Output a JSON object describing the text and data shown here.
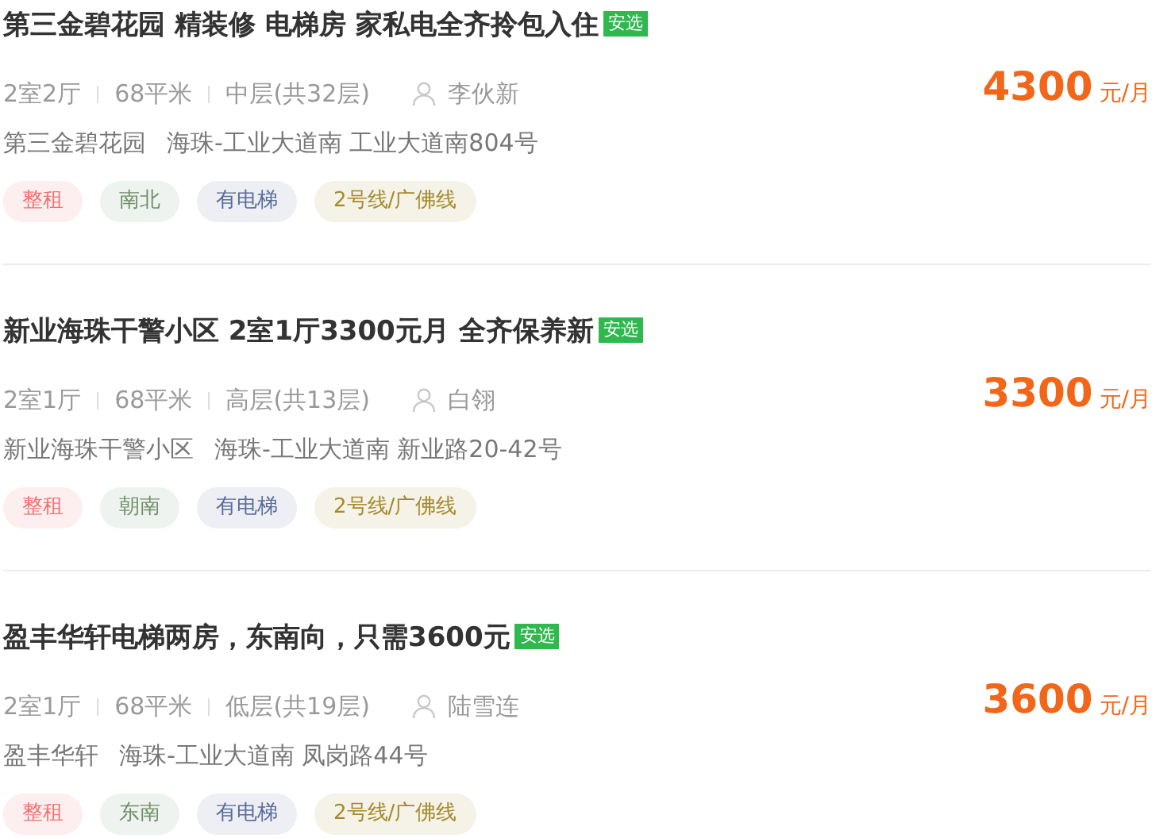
{
  "listings": [
    {
      "title": "第三金碧花园 精装修 电梯房 家私电全齐拎包入住",
      "badge": "安选",
      "layout": "2室2厅",
      "area": "68平米",
      "floor": "中层(共32层)",
      "agent": "李伙新",
      "community": "第三金碧花园",
      "address": "海珠-工业大道南 工业大道南804号",
      "price": "4300",
      "unit": "元/月",
      "tags": [
        {
          "label": "整租",
          "color": "#f07272"
        },
        {
          "label": "南北",
          "color": "#6f8f6a"
        },
        {
          "label": "有电梯",
          "color": "#5a6c9a"
        },
        {
          "label": "2号线/广佛线",
          "color": "#a48a2a"
        }
      ]
    },
    {
      "title": "新业海珠干警小区 2室1厅3300元月 全齐保养新",
      "badge": "安选",
      "layout": "2室1厅",
      "area": "68平米",
      "floor": "高层(共13层)",
      "agent": "白翎",
      "community": "新业海珠干警小区",
      "address": "海珠-工业大道南 新业路20-42号",
      "price": "3300",
      "unit": "元/月",
      "tags": [
        {
          "label": "整租",
          "color": "#f07272"
        },
        {
          "label": "朝南",
          "color": "#6f8f6a"
        },
        {
          "label": "有电梯",
          "color": "#5a6c9a"
        },
        {
          "label": "2号线/广佛线",
          "color": "#a48a2a"
        }
      ]
    },
    {
      "title": "盈丰华轩电梯两房，东南向，只需3600元",
      "badge": "安选",
      "layout": "2室1厅",
      "area": "68平米",
      "floor": "低层(共19层)",
      "agent": "陆雪连",
      "community": "盈丰华轩",
      "address": "海珠-工业大道南 凤岗路44号",
      "price": "3600",
      "unit": "元/月",
      "tags": [
        {
          "label": "整租",
          "color": "#f07272"
        },
        {
          "label": "东南",
          "color": "#6f8f6a"
        },
        {
          "label": "有电梯",
          "color": "#5a6c9a"
        },
        {
          "label": "2号线/广佛线",
          "color": "#a48a2a"
        }
      ]
    }
  ]
}
